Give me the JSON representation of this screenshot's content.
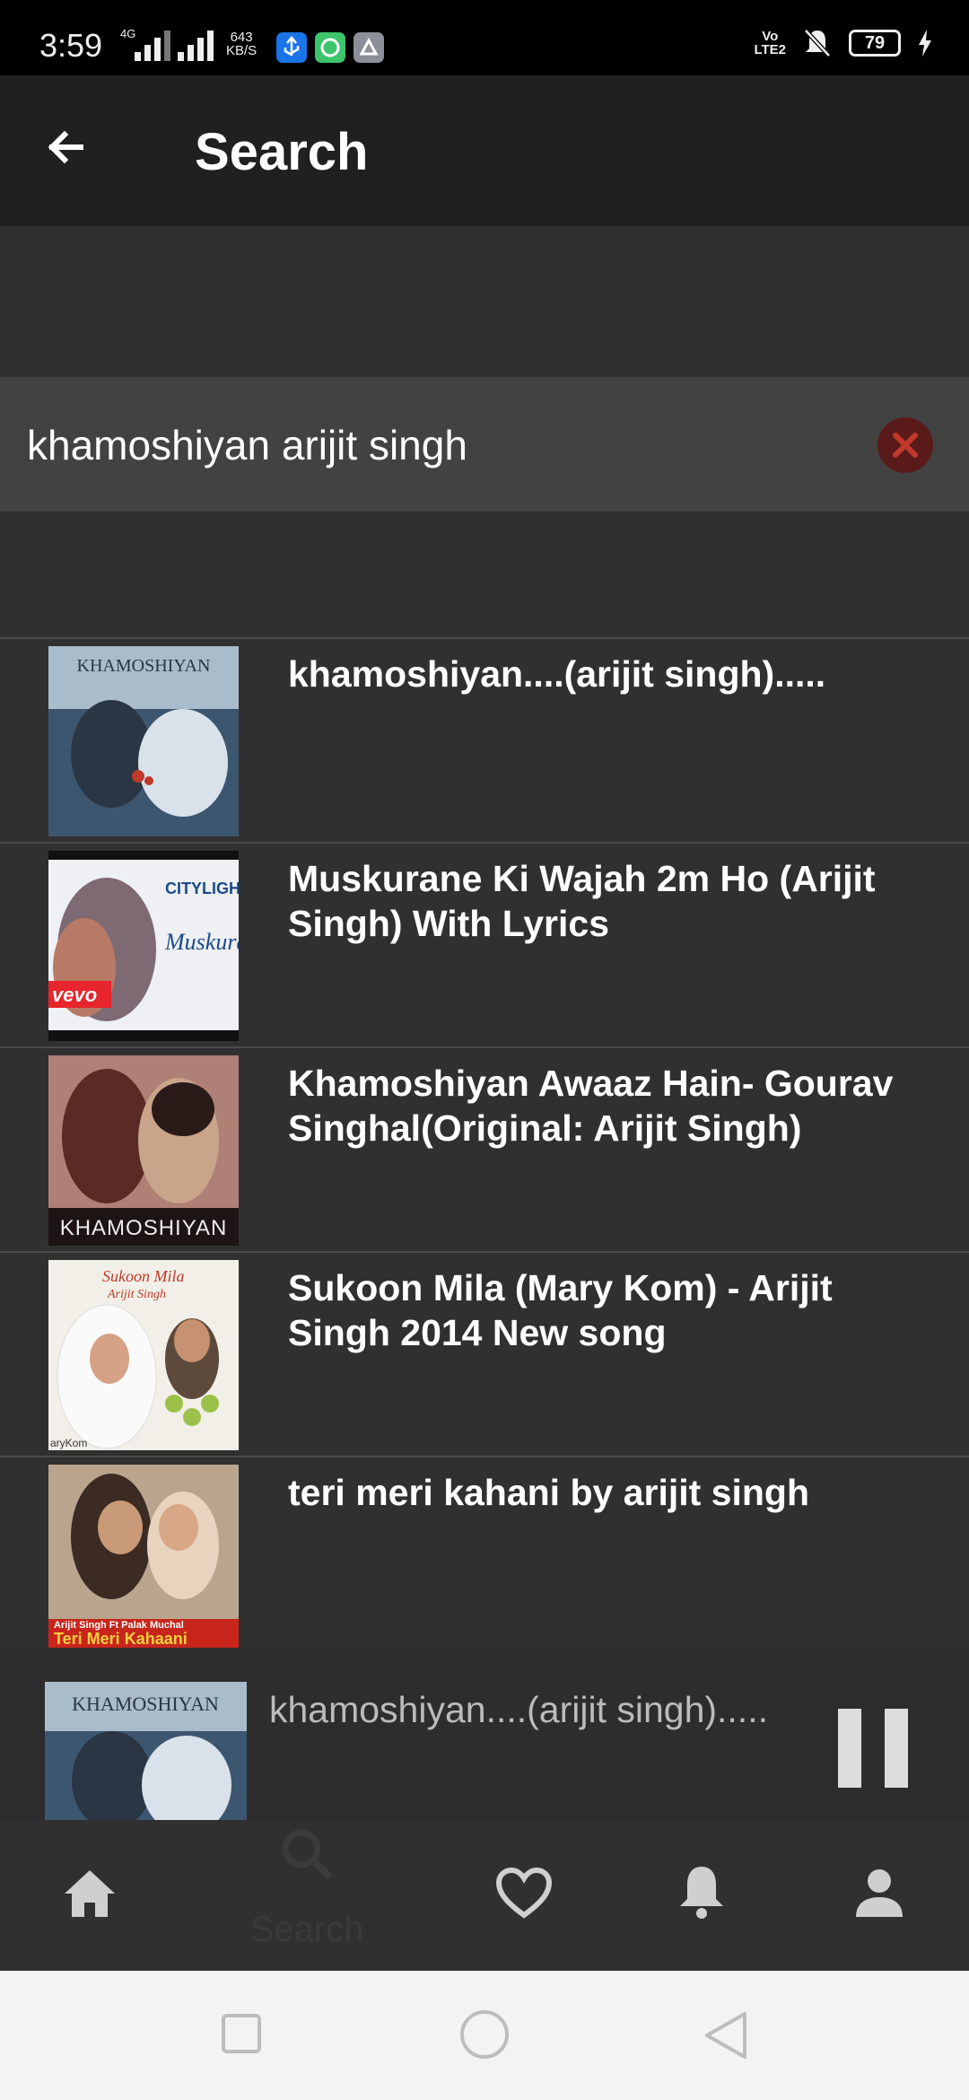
{
  "status_bar": {
    "time": "3:59",
    "network_type": "4G",
    "speed_value": "643",
    "speed_unit": "KB/S",
    "volte": "VoLTE",
    "volte_line1": "Vo",
    "volte_line2": "LTE2",
    "battery": "79"
  },
  "app_bar": {
    "title": "Search",
    "back_icon": "arrow-left-icon"
  },
  "search": {
    "value": "khamoshiyan arijit singh",
    "clear_icon": "close-circle-icon"
  },
  "results": [
    {
      "title": "khamoshiyan....(arijit singh)....."
    },
    {
      "title": "Muskurane Ki Wajah 2m Ho (Arijit Singh) With Lyrics"
    },
    {
      "title": "Khamoshiyan Awaaz Hain- Gourav Singhal(Original: Arijit Singh)"
    },
    {
      "title": "Sukoon Mila (Mary Kom) - Arijit Singh 2014 New song"
    },
    {
      "title": "teri meri kahani by arijit singh"
    }
  ],
  "thumbnails": {
    "t1_caption": "KHAMOSHIYAN",
    "t2_caption": "CITYLIGH",
    "t2_caption2": "vevo",
    "t2_script": "Muskura",
    "t3_caption": "KHAMOSHIYAN",
    "t4_caption": "Sukoon Mila",
    "t4_caption2": "Arijit Singh",
    "t4_caption3": "aryKom",
    "t5_caption": "Teri Meri Kahaani",
    "t5_caption2": "Arijit Singh Ft Palak Muchal"
  },
  "now_playing": {
    "title": "khamoshiyan....(arijit singh).....",
    "caption": "KHAMOSHIYAN",
    "pause_icon": "pause-icon"
  },
  "bottom_nav": {
    "home_icon": "home-icon",
    "search_icon": "search-icon",
    "search_label": "Search",
    "favorites_icon": "heart-icon",
    "notifications_icon": "bell-icon",
    "profile_icon": "person-icon"
  },
  "system_nav": {
    "recents_icon": "square-icon",
    "home_icon": "circle-icon",
    "back_icon": "triangle-back-icon"
  }
}
